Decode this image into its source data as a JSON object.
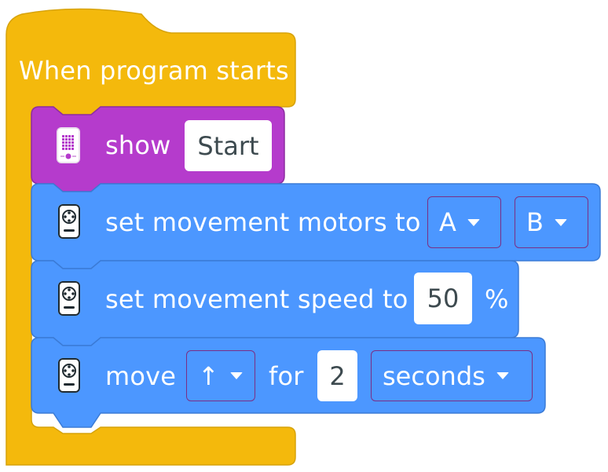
{
  "hat": {
    "label": "When program starts"
  },
  "blocks": [
    {
      "icon": "hub-light-matrix-icon",
      "text": "show",
      "inputs": {
        "message": "Start"
      }
    },
    {
      "icon": "movement-icon",
      "text": "set movement motors to",
      "inputs": {
        "port_1": "A",
        "port_2": "B"
      }
    },
    {
      "icon": "movement-icon",
      "text": "set movement speed to",
      "inputs": {
        "speed": "50",
        "unit": "%"
      }
    },
    {
      "icon": "movement-icon",
      "text": "move",
      "inputs": {
        "direction": "↑",
        "for_label": "for",
        "amount": "2",
        "unit": "seconds"
      }
    }
  ],
  "colors": {
    "events": "#f4b90c",
    "events_border": "#c99a0a",
    "display": "#b53bcc",
    "display_border": "#8d2da1",
    "movement": "#4c97ff",
    "movement_border": "#3b7bd6"
  }
}
